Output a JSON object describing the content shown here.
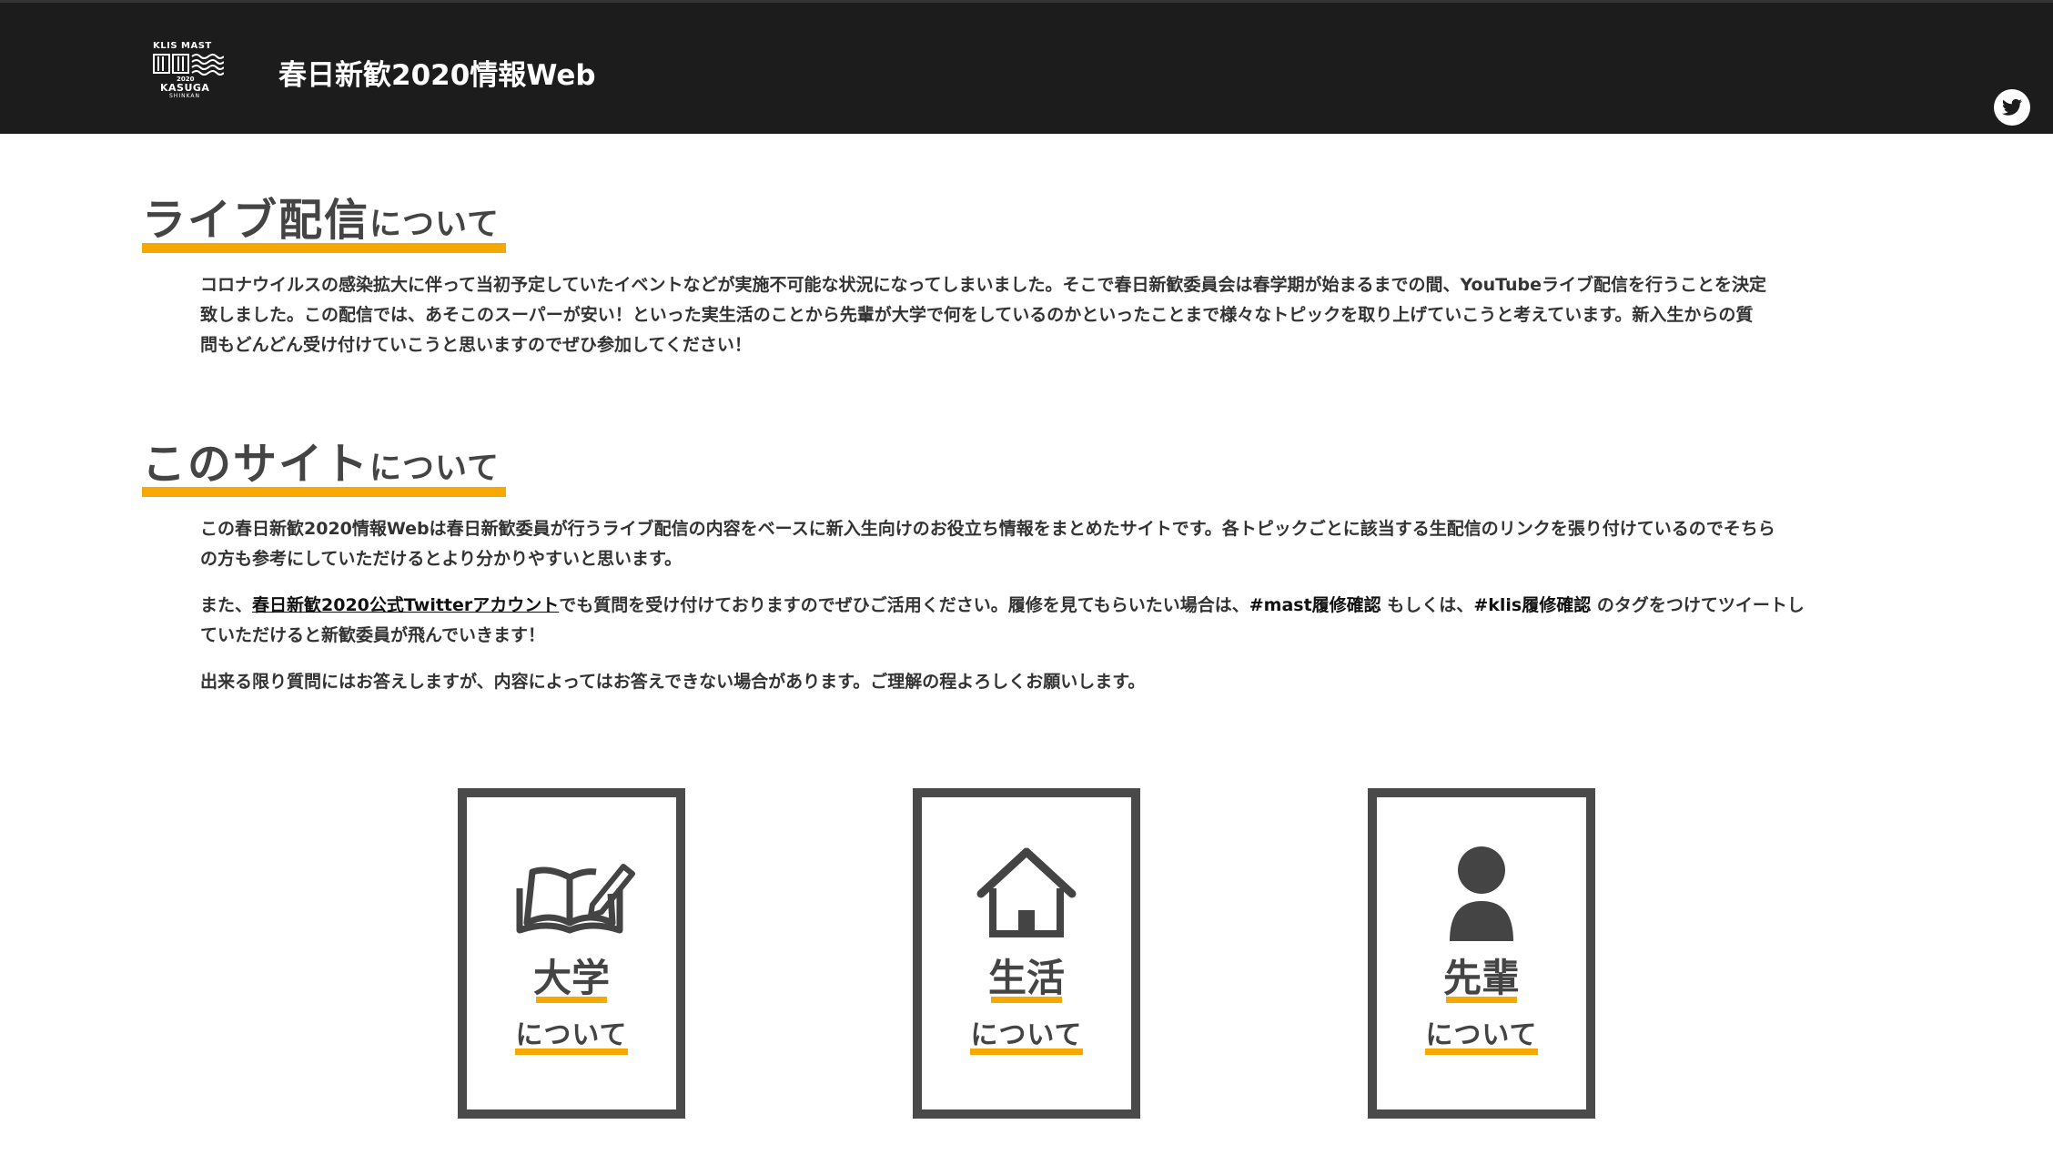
{
  "header": {
    "title": "春日新歓2020情報Web",
    "logo": {
      "top_text": "KLIS MAST",
      "year": "2020",
      "bottom_text": "KASUGA",
      "sub_text": "SHINKAN"
    },
    "twitter_icon": "twitter-icon"
  },
  "sections": {
    "live": {
      "heading_big": "ライブ配信",
      "heading_small": "について",
      "p1_line1": "コロナウイルスの感染拡大に伴って当初予定していたイベントなどが実施不可能な状況になってしまいました。そこで春日新歓委員会は春学期が始まるまでの間、YouTubeライブ配信を行うことを決定",
      "p1_line2": "致しました。この配信では、あそこのスーパーが安い！といった実生活のことから先輩が大学で何をしているのかといったことまで様々なトピックを取り上げていこうと考えています。新入生からの質",
      "p1_line3": "問もどんどん受け付けていこうと思いますのでぜひ参加してください！"
    },
    "site": {
      "heading_big": "このサイト",
      "heading_small": "について",
      "p1_line1": "この春日新歓2020情報Webは春日新歓委員が行うライブ配信の内容をベースに新入生向けのお役立ち情報をまとめたサイトです。各トピックごとに該当する生配信のリンクを張り付けているのでそちら",
      "p1_line2": "の方も参考にしていただけるとより分かりやすいと思います。",
      "p2_before": "また、",
      "p2_link": "春日新歓2020公式Twitterアカウント",
      "p2_mid1": "でも質問を受け付けておりますのでぜひご活用ください。履修を見てもらいたい場合は、",
      "p2_tag1": "#mast履修確認",
      "p2_mid2": " もしくは、",
      "p2_tag2": "#klis履修確認",
      "p2_after1": " のタグをつけてツイートし",
      "p2_line2": "ていただけると新歓委員が飛んでいきます！",
      "p3": "出来る限り質問にはお答えしますが、内容によってはお答えできない場合があります。ご理解の程よろしくお願いします。"
    }
  },
  "cards": [
    {
      "title": "大学",
      "sub": "について",
      "icon": "open-book-pencil-icon"
    },
    {
      "title": "生活",
      "sub": "について",
      "icon": "house-icon"
    },
    {
      "title": "先輩",
      "sub": "について",
      "icon": "person-icon"
    }
  ],
  "colors": {
    "accent": "#f6a800",
    "header_bg": "#1c1c1c",
    "card_border": "#4a4a4a",
    "text": "#333333"
  }
}
